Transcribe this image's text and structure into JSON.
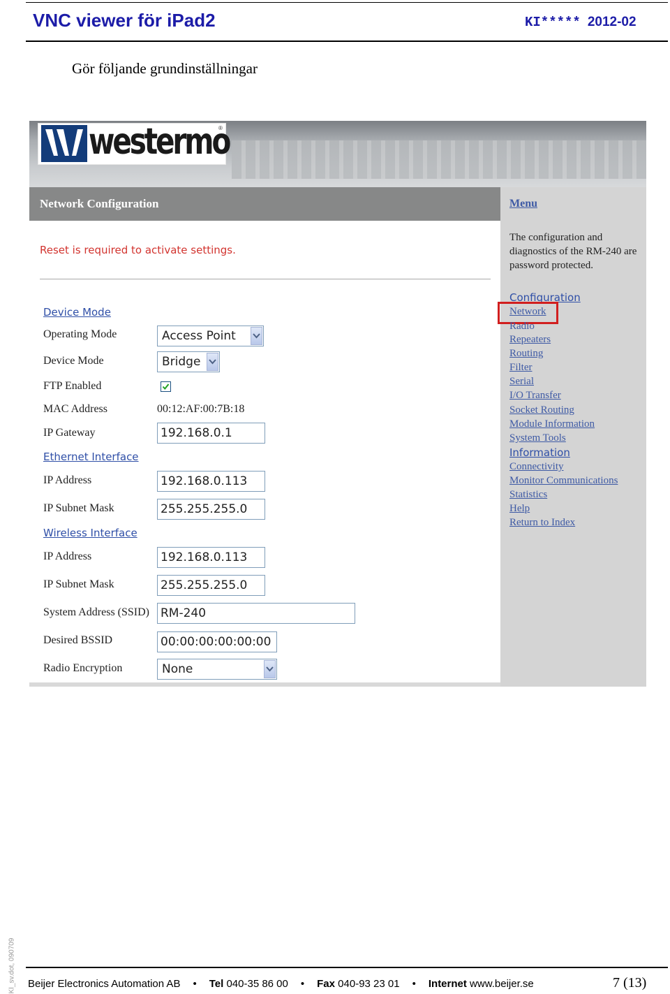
{
  "document": {
    "title": "VNC viewer för iPad2",
    "code": "KI*****",
    "date": "2012-02",
    "intro": "Gör följande grundinställningar",
    "side_tag": "KI_sv.dot, 090709"
  },
  "screenshot": {
    "logo_text": "westermo",
    "logo_registered": "®",
    "left_header": "Network Configuration",
    "reset_message": "Reset is required to activate settings.",
    "sections": {
      "device_mode": "Device Mode",
      "ethernet": "Ethernet Interface",
      "wireless": "Wireless Interface"
    },
    "fields": {
      "operating_mode": {
        "label": "Operating Mode",
        "value": "Access Point"
      },
      "device_mode": {
        "label": "Device Mode",
        "value": "Bridge"
      },
      "ftp_enabled": {
        "label": "FTP Enabled",
        "checked": true
      },
      "mac_address": {
        "label": "MAC Address",
        "value": "00:12:AF:00:7B:18"
      },
      "ip_gateway": {
        "label": "IP Gateway",
        "value": "192.168.0.1"
      },
      "eth_ip_address": {
        "label": "IP Address",
        "value": "192.168.0.113"
      },
      "eth_subnet_mask": {
        "label": "IP Subnet Mask",
        "value": "255.255.255.0"
      },
      "wl_ip_address": {
        "label": "IP Address",
        "value": "192.168.0.113"
      },
      "wl_subnet_mask": {
        "label": "IP Subnet Mask",
        "value": "255.255.255.0"
      },
      "ssid": {
        "label": "System Address (SSID)",
        "value": "RM-240"
      },
      "bssid": {
        "label": "Desired BSSID",
        "value": "00:00:00:00:00:00"
      },
      "encryption": {
        "label": "Radio Encryption",
        "value": "None"
      }
    },
    "menu": {
      "title": "Menu",
      "description": "The configuration and diagnostics of the RM-240 are password protected.",
      "configuration": "Configuration",
      "network": "Network",
      "radio": "Radio",
      "repeaters": "Repeaters",
      "routing": "Routing",
      "filter": "Filter",
      "serial": "Serial",
      "io_transfer": "I/O Transfer",
      "socket_routing": "Socket Routing",
      "module_information": "Module Information",
      "system_tools": "System Tools",
      "information": "Information",
      "connectivity": "Connectivity",
      "monitor_communications": "Monitor Communications",
      "statistics": "Statistics",
      "help": "Help",
      "return_to_index": "Return to Index"
    },
    "colors": {
      "section_blue": "#2f4fa7",
      "reset_red": "#d2342f",
      "highlight_red": "#d11f1f",
      "header_gray": "#878888",
      "menu_gray": "#d4d4d4"
    }
  },
  "footer": {
    "company": "Beijer Electronics Automation AB",
    "tel_label": "Tel",
    "tel": "040-35 86 00",
    "fax_label": "Fax",
    "fax": "040-93 23 01",
    "internet_label": "Internet",
    "internet": "www.beijer.se",
    "page": "7 (13)",
    "separator": "•"
  }
}
